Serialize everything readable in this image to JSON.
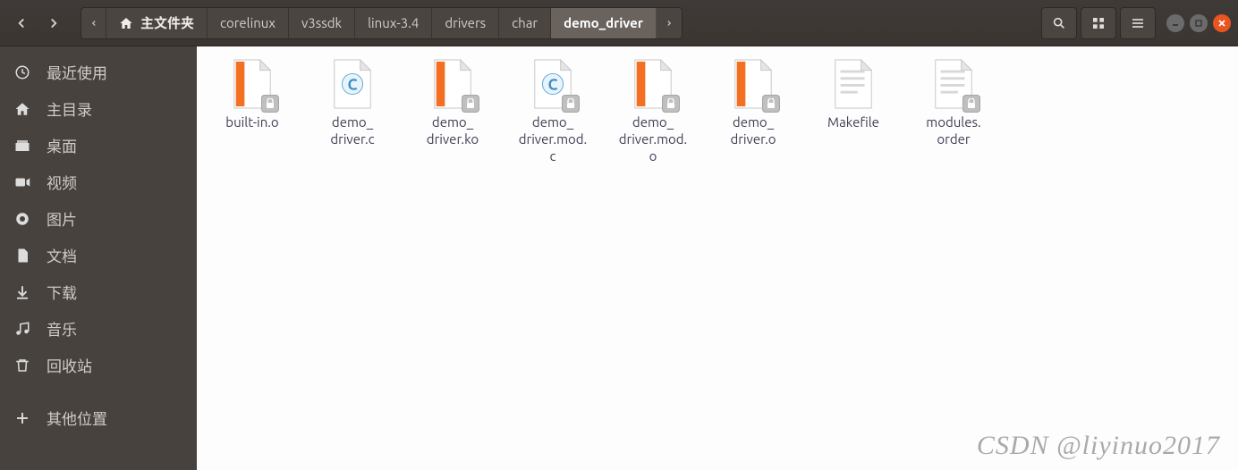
{
  "nav": {
    "back_icon": "chevron-left-icon",
    "forward_icon": "chevron-right-icon"
  },
  "breadcrumbs": {
    "scroll_left_icon": "chevron-left-small-icon",
    "scroll_right_icon": "chevron-right-small-icon",
    "home_icon": "home-icon",
    "items": [
      {
        "label": "主文件夹",
        "is_home": true,
        "active": false
      },
      {
        "label": "corelinux",
        "active": false
      },
      {
        "label": "v3ssdk",
        "active": false
      },
      {
        "label": "linux-3.4",
        "active": false
      },
      {
        "label": "drivers",
        "active": false
      },
      {
        "label": "char",
        "active": false
      },
      {
        "label": "demo_driver",
        "active": true
      }
    ]
  },
  "toolbar": {
    "search_icon": "search-icon",
    "view_icon": "grid-view-icon",
    "menu_icon": "hamburger-icon",
    "min_icon": "minimize-icon",
    "max_icon": "maximize-icon",
    "close_icon": "close-icon"
  },
  "sidebar": {
    "items": [
      {
        "icon": "recent-icon",
        "label": "最近使用"
      },
      {
        "icon": "home-icon",
        "label": "主目录"
      },
      {
        "icon": "desktop-icon",
        "label": "桌面"
      },
      {
        "icon": "videos-icon",
        "label": "视频"
      },
      {
        "icon": "pictures-icon",
        "label": "图片"
      },
      {
        "icon": "documents-icon",
        "label": "文档"
      },
      {
        "icon": "downloads-icon",
        "label": "下载"
      },
      {
        "icon": "music-icon",
        "label": "音乐"
      },
      {
        "icon": "trash-icon",
        "label": "回收站"
      }
    ],
    "other": {
      "icon": "plus-icon",
      "label": "其他位置"
    }
  },
  "files": [
    {
      "name": "built-in.o",
      "icon": "obj-file",
      "locked": true
    },
    {
      "name": "demo_\ndriver.c",
      "icon": "c-file",
      "locked": false
    },
    {
      "name": "demo_\ndriver.ko",
      "icon": "obj-file",
      "locked": true
    },
    {
      "name": "demo_\ndriver.mod.\nc",
      "icon": "c-file",
      "locked": true
    },
    {
      "name": "demo_\ndriver.mod.\no",
      "icon": "obj-file",
      "locked": true
    },
    {
      "name": "demo_\ndriver.o",
      "icon": "obj-file",
      "locked": true
    },
    {
      "name": "Makefile",
      "icon": "text-file",
      "locked": false
    },
    {
      "name": "modules.\norder",
      "icon": "text-file",
      "locked": true
    }
  ],
  "watermark": "CSDN @liyinuo2017"
}
